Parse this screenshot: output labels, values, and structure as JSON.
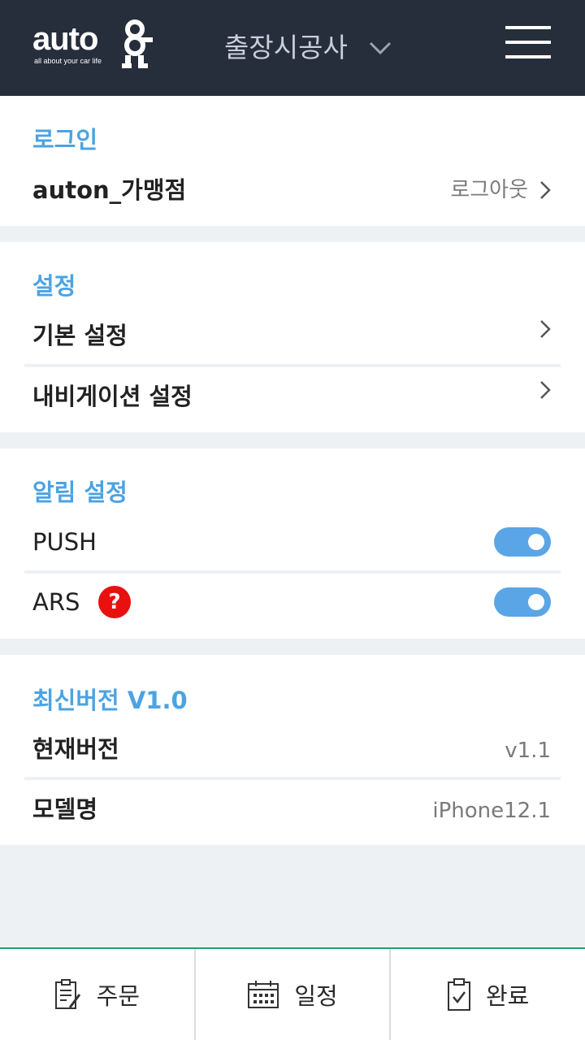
{
  "header": {
    "logo_text": "auto",
    "logo_tagline": "all about your car life",
    "title": "출장시공사"
  },
  "sections": {
    "login": {
      "title": "로그인",
      "account": "auton_가맹점",
      "logout_label": "로그아웃"
    },
    "settings": {
      "title": "설정",
      "items": [
        {
          "label": "기본 설정"
        },
        {
          "label": "내비게이션 설정"
        }
      ]
    },
    "notifications": {
      "title": "알림 설정",
      "push": {
        "label": "PUSH",
        "on": true
      },
      "ars": {
        "label": "ARS",
        "help": "?",
        "on": true
      }
    },
    "version": {
      "title": "최신버전 V1.0",
      "current_label": "현재버전",
      "current_value": "v1.1",
      "model_label": "모델명",
      "model_value": "iPhone12.1"
    }
  },
  "tabbar": {
    "tabs": [
      {
        "label": "주문",
        "icon": "order-clipboard-icon"
      },
      {
        "label": "일정",
        "icon": "calendar-icon"
      },
      {
        "label": "완료",
        "icon": "check-clipboard-icon"
      }
    ]
  },
  "colors": {
    "header_bg": "#262d3b",
    "accent_blue": "#4ba3e3",
    "toggle_on": "#5aa5e6",
    "help_red": "#e8110f",
    "tabbar_border": "#2f9a6e"
  }
}
